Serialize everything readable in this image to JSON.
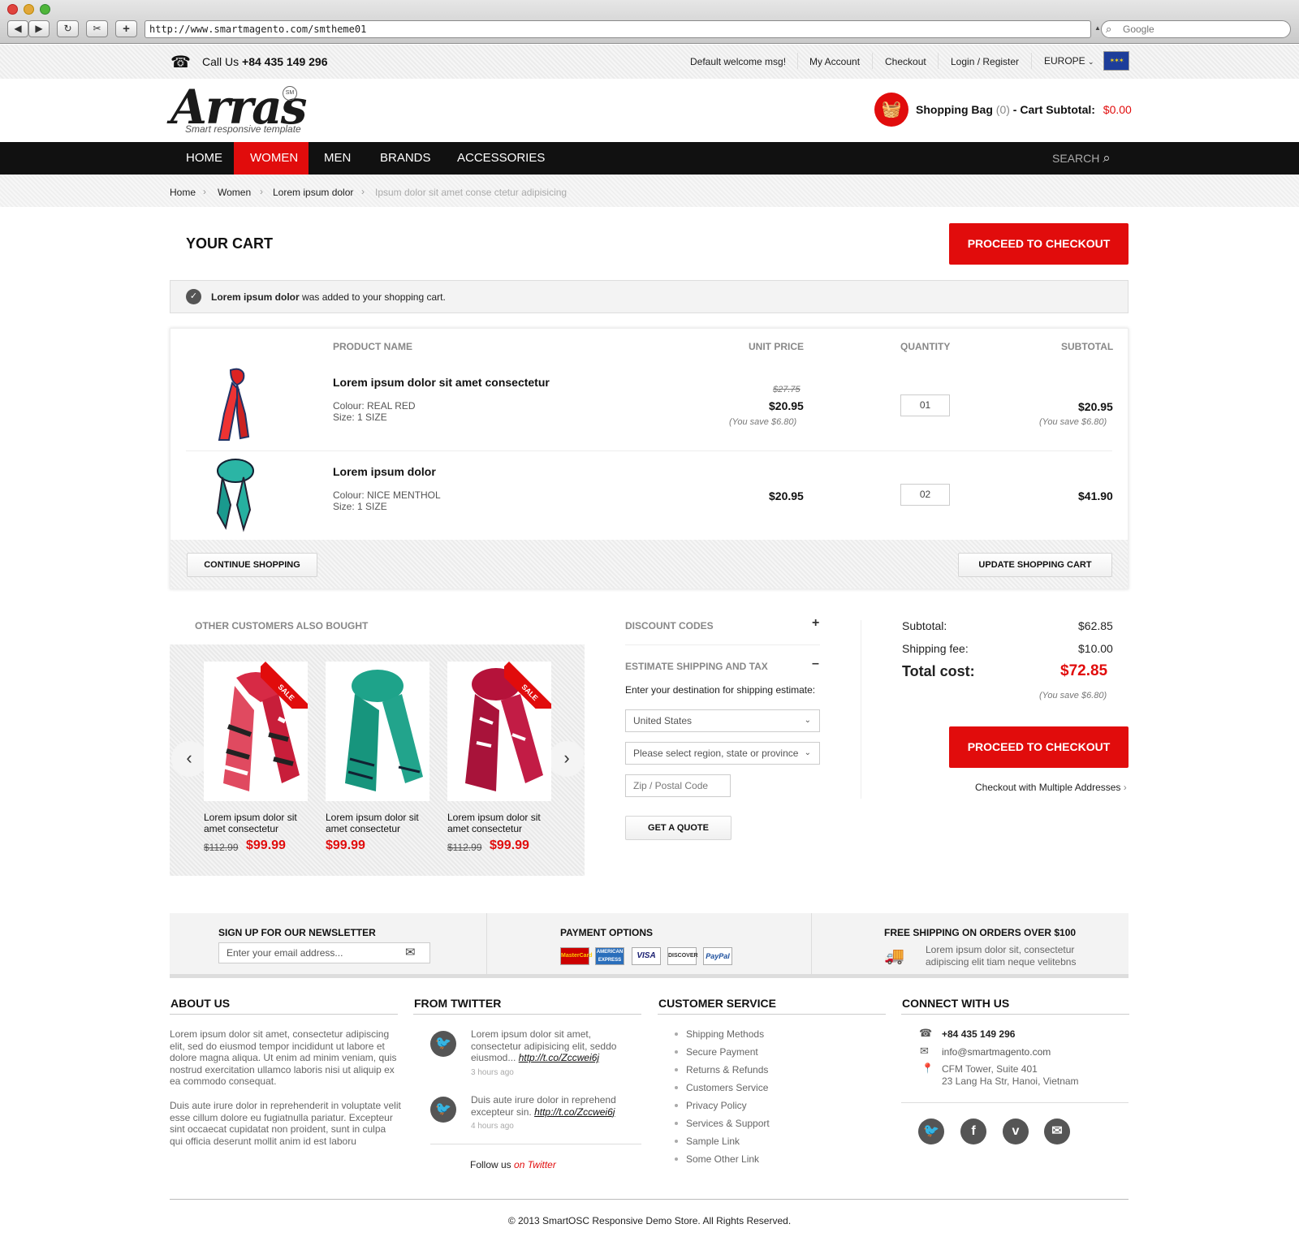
{
  "browser": {
    "url": "http://www.smartmagento.com/smtheme01",
    "search_placeholder": "Google"
  },
  "topbar": {
    "call_prefix": "Call Us",
    "phone": "+84 435 149 296",
    "links": [
      "Default welcome msg!",
      "My Account",
      "Checkout",
      "Login / Register"
    ],
    "region": "EUROPE"
  },
  "header": {
    "logo": "Arras",
    "logo_badge": "SM",
    "tagline": "Smart responsive template",
    "bag_label": "Shopping Bag",
    "bag_count": "(0)",
    "subtotal_label": "- Cart Subtotal:",
    "subtotal_value": "$0.00"
  },
  "nav": {
    "items": [
      "HOME",
      "WOMEN",
      "MEN",
      "BRANDS",
      "ACCESSORIES"
    ],
    "active": "WOMEN",
    "search": "SEARCH"
  },
  "breadcrumb": [
    "Home",
    "Women",
    "Lorem ipsum dolor",
    "Ipsum dolor sit amet conse ctetur adipisicing"
  ],
  "cart": {
    "title": "YOUR CART",
    "checkout_label": "PROCEED TO CHECKOUT",
    "notice_bold": "Lorem ipsum dolor",
    "notice_rest": " was added to your shopping cart.",
    "columns": [
      "PRODUCT NAME",
      "UNIT PRICE",
      "QUANTITY",
      "SUBTOTAL"
    ],
    "items": [
      {
        "name": "Lorem ipsum dolor sit amet consectetur",
        "colour": "Colour: REAL RED",
        "size": "Size: 1 SIZE",
        "old_price": "$27.75",
        "unit_price": "$20.95",
        "unit_save": "(You save $6.80)",
        "qty": "01",
        "subtotal": "$20.95",
        "sub_save": "(You save $6.80)"
      },
      {
        "name": "Lorem ipsum dolor",
        "colour": "Colour: NICE MENTHOL",
        "size": "Size: 1 SIZE",
        "unit_price": "$20.95",
        "qty": "02",
        "subtotal": "$41.90"
      }
    ],
    "continue_label": "CONTINUE SHOPPING",
    "update_label": "UPDATE SHOPPING CART"
  },
  "also_bought": {
    "title": "OTHER CUSTOMERS ALSO BOUGHT",
    "sale_tag": "SALE",
    "products": [
      {
        "name": "Lorem ipsum dolor sit amet consectetur",
        "old": "$112.99",
        "price": "$99.99",
        "sale": true
      },
      {
        "name": "Lorem ipsum dolor sit amet consectetur",
        "old": "",
        "price": "$99.99",
        "sale": false
      },
      {
        "name": "Lorem ipsum dolor sit amet consectetur",
        "old": "$112.99",
        "price": "$99.99",
        "sale": true
      }
    ]
  },
  "discount": {
    "title": "DISCOUNT CODES",
    "toggle": "+"
  },
  "shipping": {
    "title": "ESTIMATE SHIPPING AND TAX",
    "toggle": "–",
    "intro": "Enter your destination for shipping estimate:",
    "country": "United States",
    "region": "Please select region, state or province",
    "zip_placeholder": "Zip / Postal Code",
    "quote_label": "GET A QUOTE"
  },
  "totals": {
    "subtotal_label": "Subtotal:",
    "subtotal": "$62.85",
    "shipping_label": "Shipping fee:",
    "shipping": "$10.00",
    "total_label": "Total cost:",
    "total": "$72.85",
    "save": "(You save $6.80)",
    "checkout_label": "PROCEED TO CHECKOUT",
    "multi_label": "Checkout with Multiple Addresses"
  },
  "footer_strip": {
    "newsletter_title": "SIGN UP FOR OUR NEWSLETTER",
    "newsletter_placeholder": "Enter your email address...",
    "payment_title": "PAYMENT OPTIONS",
    "cards": [
      "MasterCard",
      "AMERICAN EXPRESS",
      "VISA",
      "DISCOVER",
      "PayPal"
    ],
    "shipping_title": "FREE SHIPPING ON ORDERS OVER $100",
    "shipping_text1": "Lorem ipsum dolor sit, consectetur",
    "shipping_text2": "adipiscing elit tiam neque velitebns"
  },
  "about": {
    "title": "ABOUT US",
    "p1": "Lorem ipsum dolor sit amet, consectetur adipiscing elit, sed do eiusmod tempor incididunt ut labore et dolore magna aliqua. Ut enim ad minim veniam, quis nostrud exercitation ullamco laboris nisi ut aliquip ex ea commodo consequat.",
    "p2": "Duis aute irure dolor in reprehenderit in voluptate velit esse cillum dolore eu fugiatnulla pariatur. Excepteur sint occaecat cupidatat non proident, sunt in culpa qui officia deserunt mollit anim id est laboru"
  },
  "twitter": {
    "title": "FROM TWITTER",
    "tweets": [
      {
        "text": "Lorem ipsum dolor sit amet, consectetur adipisicing elit, seddo eiusmod...",
        "link": "http://t.co/Zccwei6j",
        "time": "3 hours ago"
      },
      {
        "text": "Duis aute irure dolor in reprehend excepteur sin.",
        "link": "http://t.co/Zccwei6j",
        "time": "4 hours ago"
      }
    ],
    "follow": "Follow us",
    "follow_link": "on Twitter"
  },
  "customer_service": {
    "title": "CUSTOMER SERVICE",
    "links": [
      "Shipping Methods",
      "Secure Payment",
      "Returns & Refunds",
      "Customers Service",
      "Privacy Policy",
      "Services & Support",
      "Sample Link",
      "Some Other Link"
    ]
  },
  "connect": {
    "title": "CONNECT WITH US",
    "phone": "+84 435 149 296",
    "email": "info@smartmagento.com",
    "address1": "CFM Tower, Suite 401",
    "address2": "23 Lang Ha Str, Hanoi, Vietnam"
  },
  "copyright": "© 2013 SmartOSC Responsive Demo Store. All Rights Reserved.",
  "colors": {
    "accent": "#e10c0c",
    "nav": "#111111"
  }
}
